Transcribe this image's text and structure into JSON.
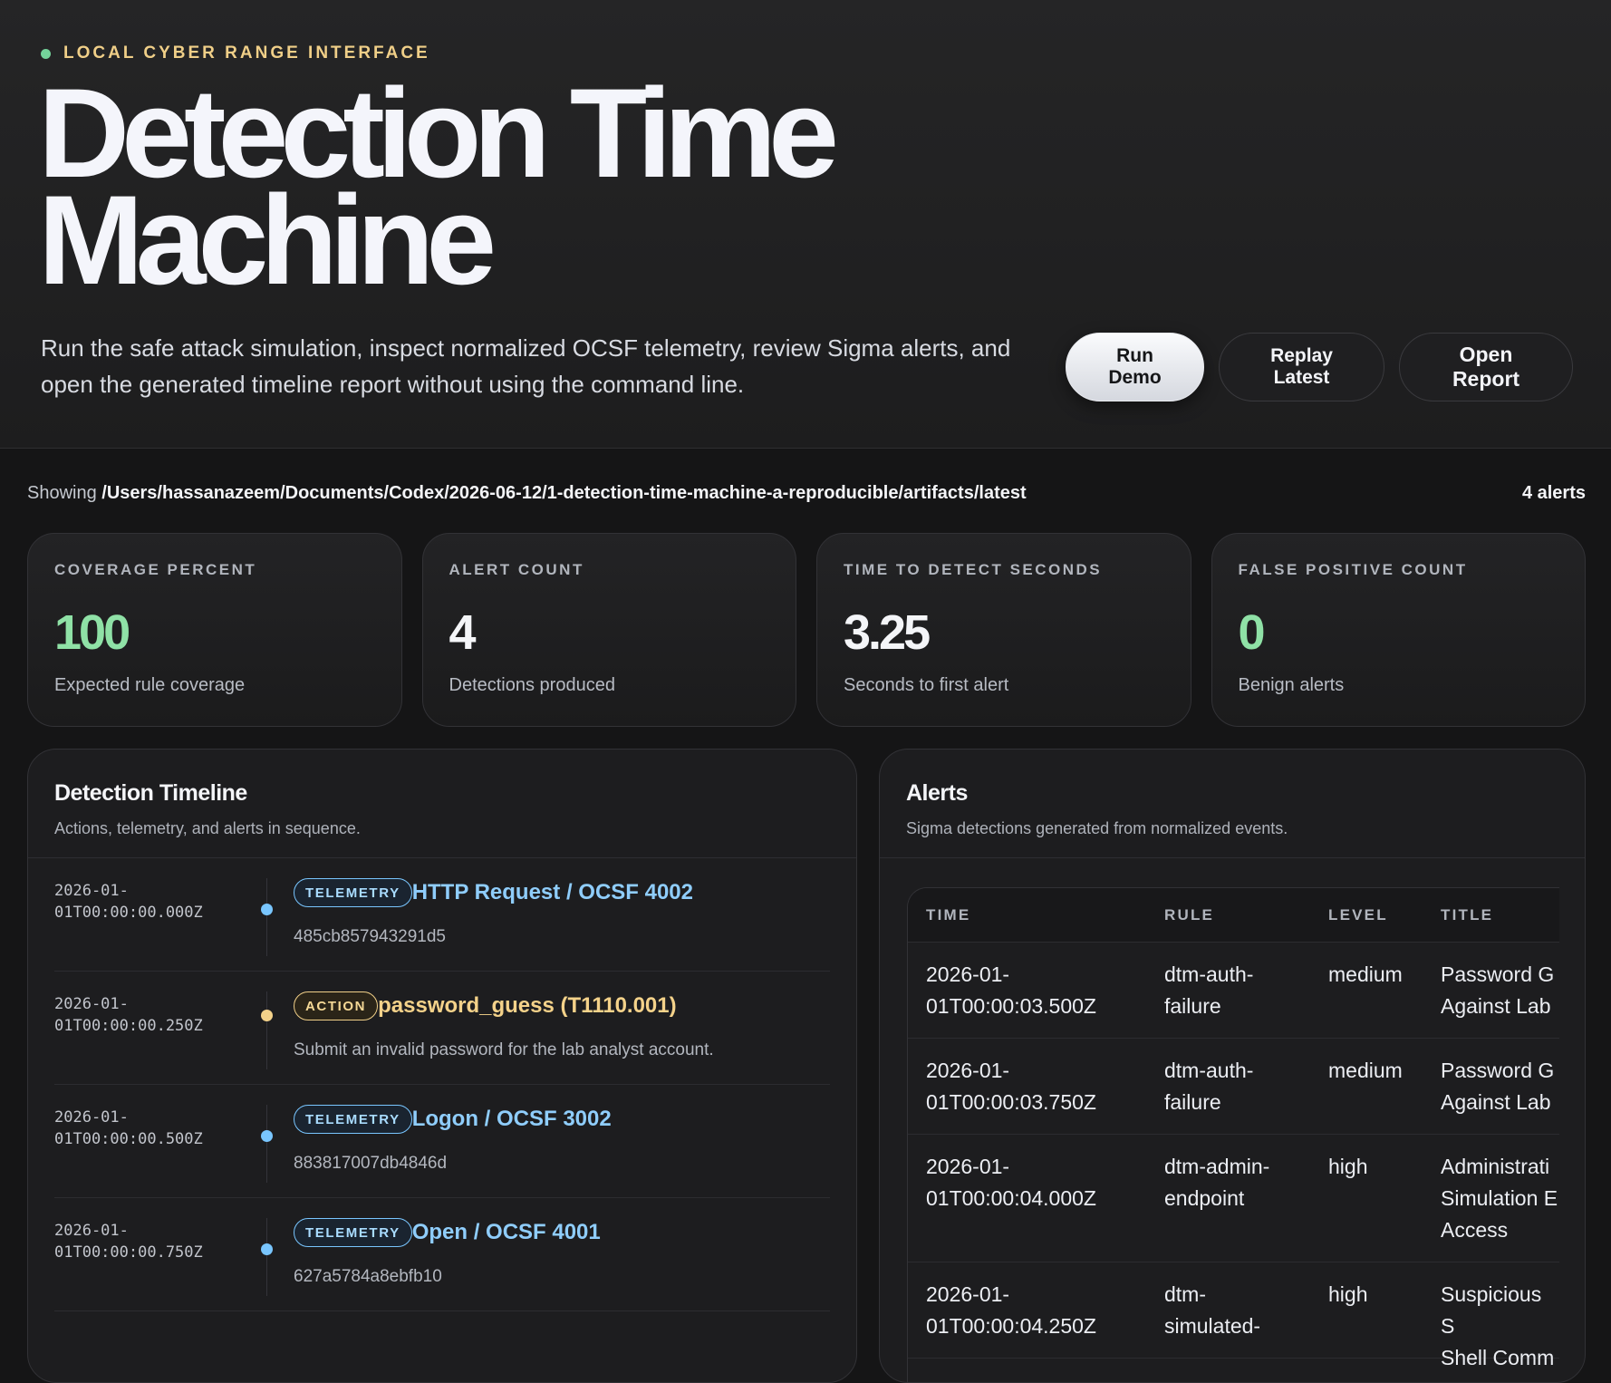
{
  "header": {
    "eyebrow": "LOCAL CYBER RANGE INTERFACE",
    "title": "Detection Time Machine",
    "lede": "Run the safe attack simulation, inspect normalized OCSF telemetry, review Sigma alerts, and open the generated timeline report without using the command line.",
    "buttons": {
      "run": "Run Demo",
      "replay": "Replay Latest",
      "report": "Open Report"
    }
  },
  "status": {
    "prefix": "Showing",
    "path": "/Users/hassanazeem/Documents/Codex/2026-06-12/1-detection-time-machine-a-reproducible/artifacts/latest",
    "alert_count": "4 alerts"
  },
  "metrics": [
    {
      "label": "COVERAGE PERCENT",
      "value": "100",
      "note": "Expected rule coverage"
    },
    {
      "label": "ALERT COUNT",
      "value": "4",
      "note": "Detections produced"
    },
    {
      "label": "TIME TO DETECT SECONDS",
      "value": "3.25",
      "note": "Seconds to first alert"
    },
    {
      "label": "FALSE POSITIVE COUNT",
      "value": "0",
      "note": "Benign alerts"
    }
  ],
  "timeline": {
    "title": "Detection Timeline",
    "subtitle": "Actions, telemetry, and alerts in sequence.",
    "items": [
      {
        "time": "2026-01-\n01T00:00:00.000Z",
        "tag": "TELEMETRY",
        "title": "HTTP Request / OCSF 4002",
        "sub": "485cb857943291d5"
      },
      {
        "time": "2026-01-\n01T00:00:00.250Z",
        "tag": "ACTION",
        "title": "password_guess (T1110.001)",
        "sub": "Submit an invalid password for the lab analyst account."
      },
      {
        "time": "2026-01-\n01T00:00:00.500Z",
        "tag": "TELEMETRY",
        "title": "Logon / OCSF 3002",
        "sub": "883817007db4846d"
      },
      {
        "time": "2026-01-\n01T00:00:00.750Z",
        "tag": "TELEMETRY",
        "title": "Open / OCSF 4001",
        "sub": "627a5784a8ebfb10"
      }
    ]
  },
  "alerts": {
    "title": "Alerts",
    "subtitle": "Sigma detections generated from normalized events.",
    "columns": [
      "TIME",
      "RULE",
      "LEVEL",
      "TITLE"
    ],
    "rows": [
      {
        "time": "2026-01-\n01T00:00:03.500Z",
        "rule": "dtm-auth-\nfailure",
        "level": "medium",
        "title": "Password G\nAgainst Lab"
      },
      {
        "time": "2026-01-\n01T00:00:03.750Z",
        "rule": "dtm-auth-\nfailure",
        "level": "medium",
        "title": "Password G\nAgainst Lab"
      },
      {
        "time": "2026-01-\n01T00:00:04.000Z",
        "rule": "dtm-admin-\nendpoint",
        "level": "high",
        "title": "Administrati\nSimulation E\nAccess"
      },
      {
        "time": "2026-01-\n01T00:00:04.250Z",
        "rule": "dtm-\nsimulated-",
        "level": "high",
        "title": "Suspicious S\nShell Comm"
      }
    ]
  },
  "colors": {
    "accent_green": "#8fe1a6",
    "accent_blue": "#79c6ff",
    "accent_amber": "#f0cf88",
    "background": "#151516"
  }
}
